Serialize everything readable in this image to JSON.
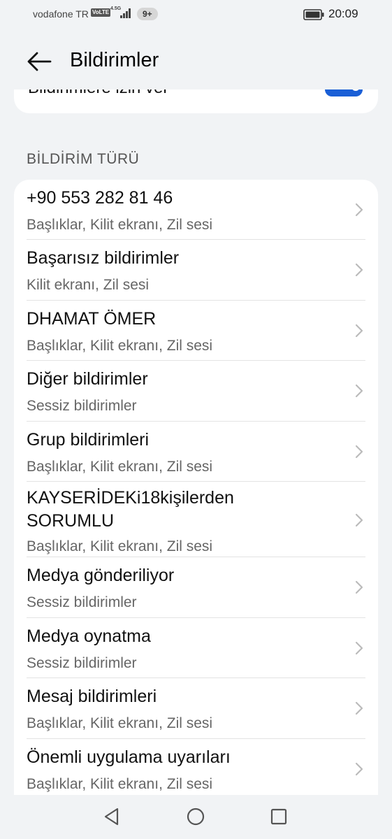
{
  "status_bar": {
    "carrier": "vodafone TR",
    "volte": "VoLTE",
    "network": "4.5G",
    "notification_count": "9+",
    "time": "20:09"
  },
  "header": {
    "title": "Bildirimler",
    "back_icon": "arrow-left-icon"
  },
  "top_card": {
    "label": "Bildirimlere izin ver",
    "toggle_on": true,
    "toggle_color": "#1a5fd6"
  },
  "section": {
    "title": "BİLDİRİM TÜRÜ"
  },
  "items": [
    {
      "title": "+90 553 282 81 46",
      "subtitle": "Başlıklar, Kilit ekranı, Zil sesi"
    },
    {
      "title": "Başarısız bildirimler",
      "subtitle": "Kilit ekranı, Zil sesi"
    },
    {
      "title": "DHAMAT ÖMER",
      "subtitle": "Başlıklar, Kilit ekranı, Zil sesi"
    },
    {
      "title": "Diğer bildirimler",
      "subtitle": "Sessiz bildirimler"
    },
    {
      "title": "Grup bildirimleri",
      "subtitle": "Başlıklar, Kilit ekranı, Zil sesi"
    },
    {
      "title": "KAYSERİDEKi18kişilerden",
      "title2": "SORUMLU",
      "subtitle": "Başlıklar, Kilit ekranı, Zil sesi"
    },
    {
      "title": "Medya gönderiliyor",
      "subtitle": "Sessiz bildirimler"
    },
    {
      "title": "Medya oynatma",
      "subtitle": "Sessiz bildirimler"
    },
    {
      "title": "Mesaj bildirimleri",
      "subtitle": "Başlıklar, Kilit ekranı, Zil sesi"
    },
    {
      "title": "Önemli uygulama uyarıları",
      "subtitle": "Başlıklar, Kilit ekranı, Zil sesi"
    }
  ],
  "nav_bar": {
    "back": "triangle-back-icon",
    "home": "circle-home-icon",
    "recents": "square-recents-icon"
  }
}
